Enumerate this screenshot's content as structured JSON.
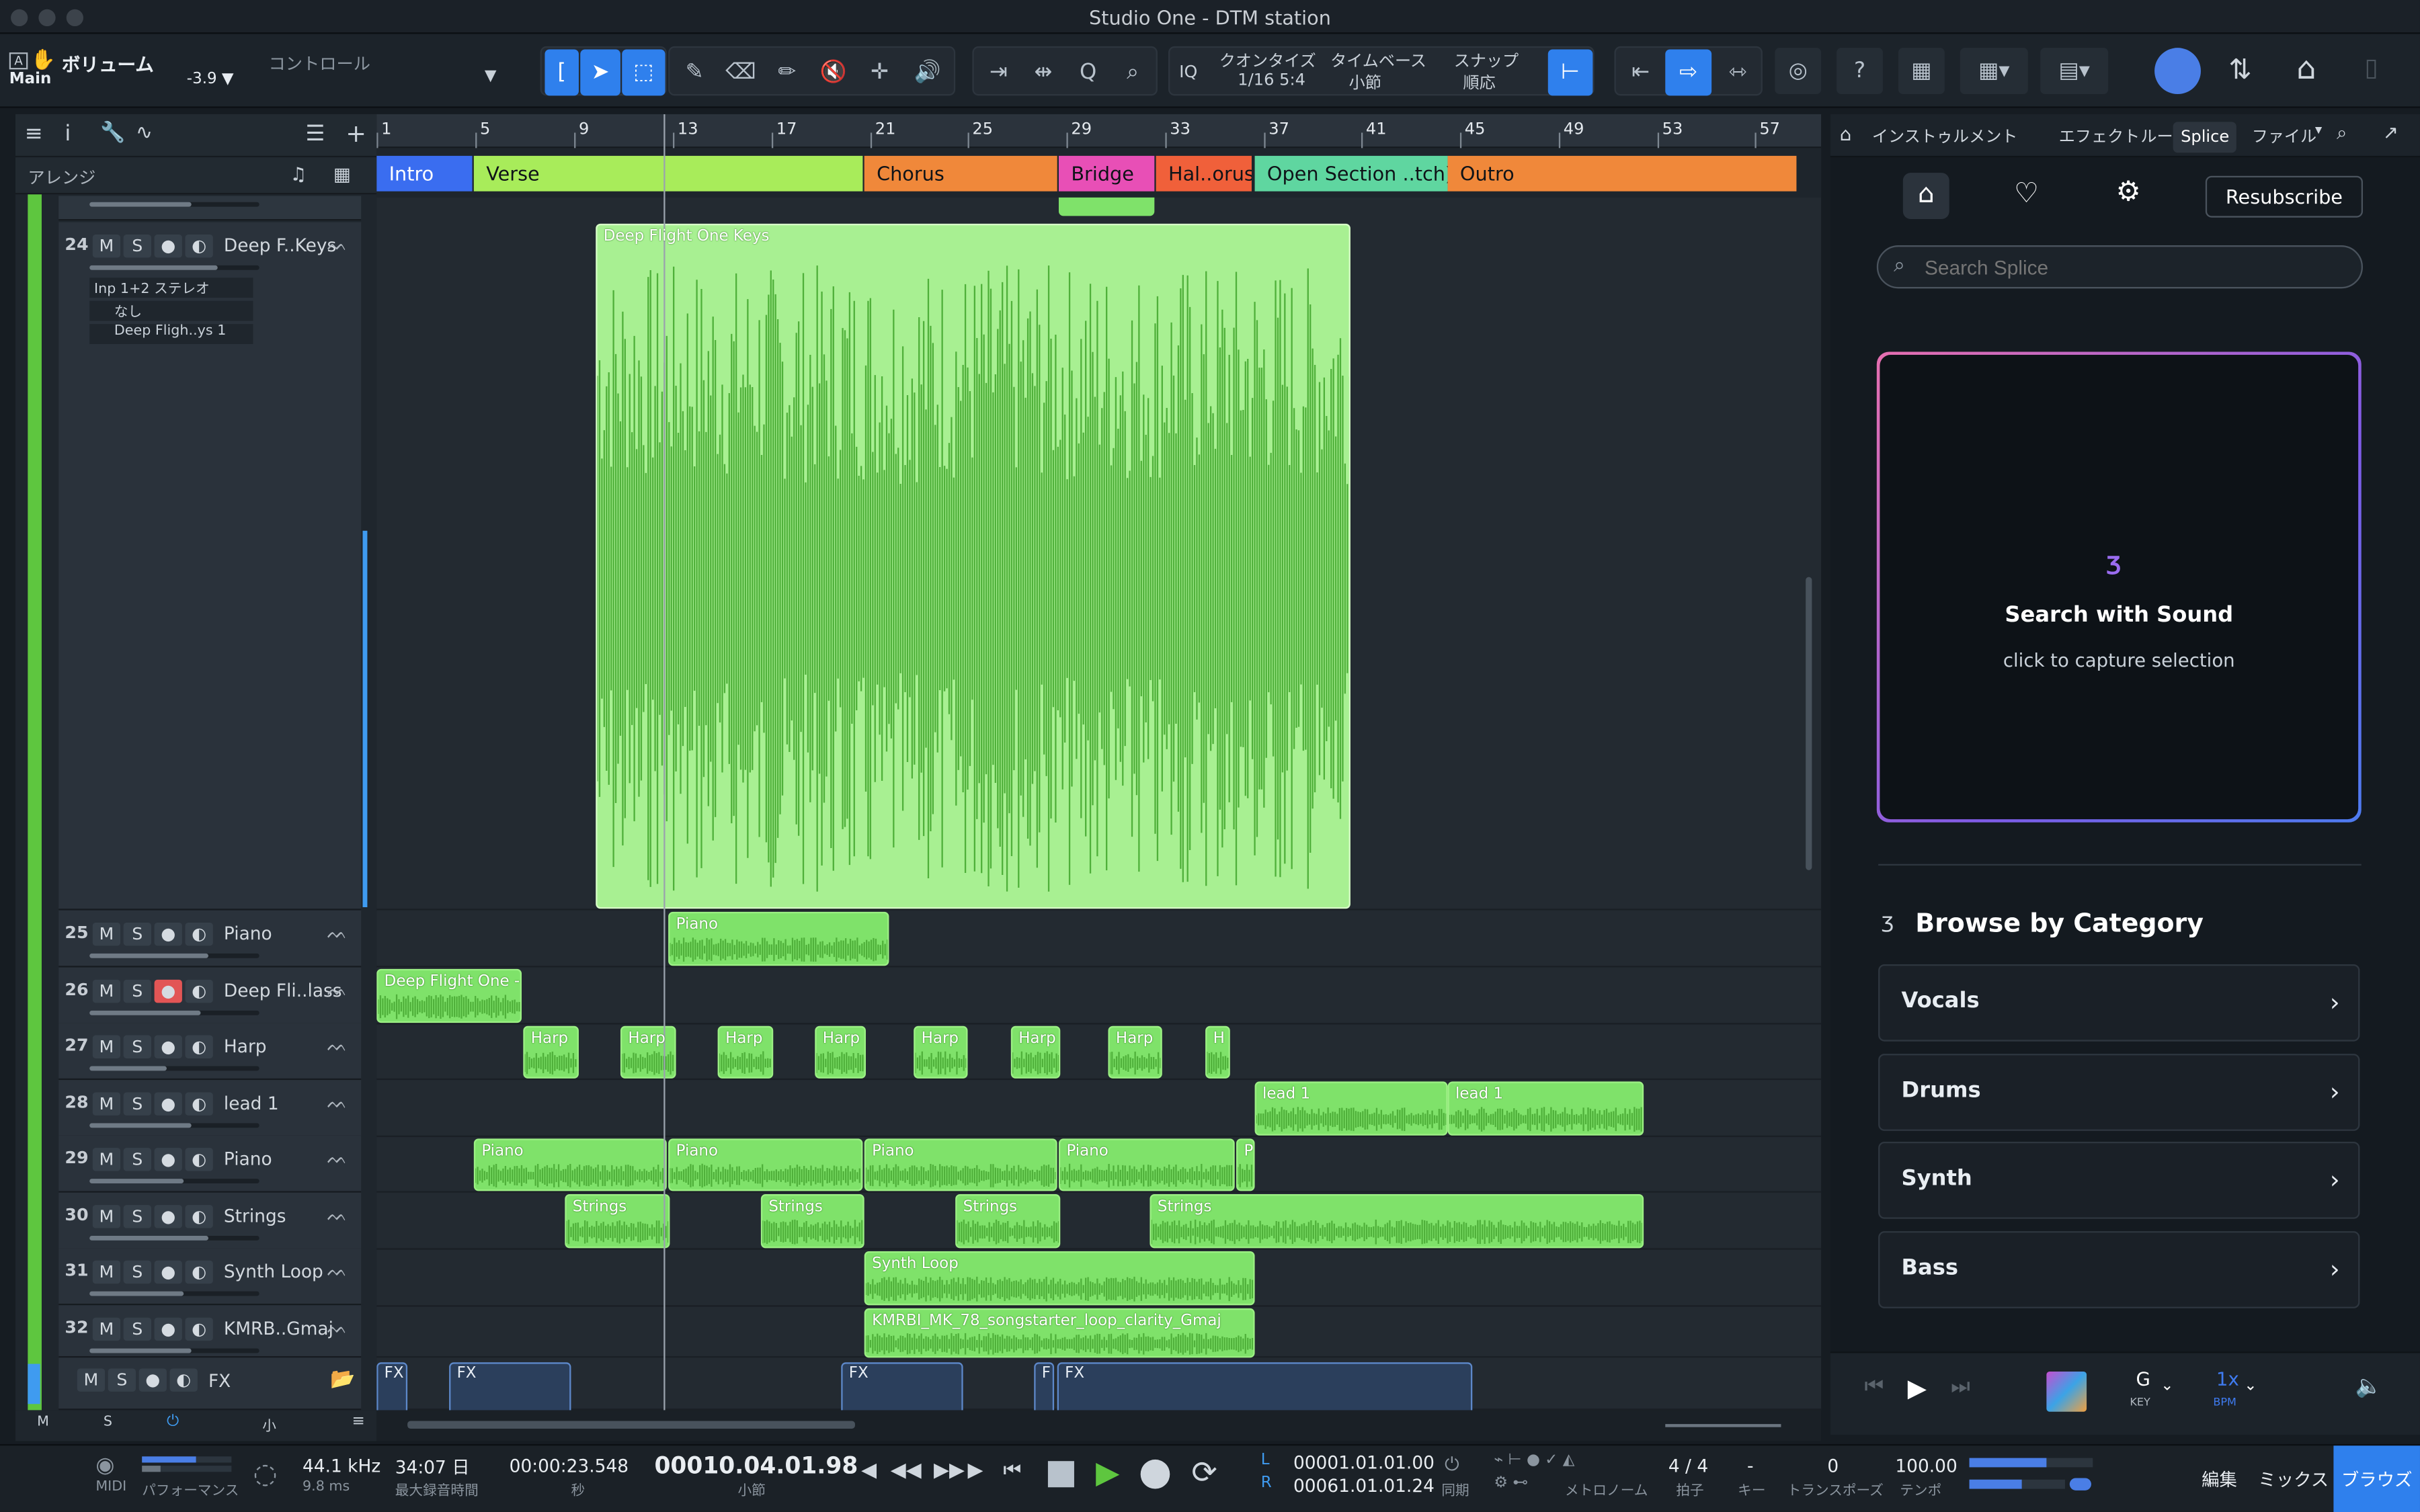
{
  "window": {
    "title": "Studio One - DTM station"
  },
  "toolbar": {
    "left_top": "A",
    "volume_label": "ボリューム",
    "control_label": "コントロール",
    "main_label": "Main",
    "volume_value": "-3.9 ▼",
    "iq": "IQ",
    "quantize_label": "クオンタイズ",
    "quantize_value": "1/16 5:4",
    "timebase_label": "タイムベース",
    "timebase_value": "小節",
    "snap_label": "スナップ",
    "snap_value": "順応",
    "help": "?"
  },
  "arrange_header": {
    "label": "アレンジ"
  },
  "ruler": {
    "bars": [
      "1",
      "5",
      "9",
      "13",
      "17",
      "21",
      "25",
      "29",
      "33",
      "37",
      "41",
      "45",
      "49",
      "53",
      "57"
    ]
  },
  "markers": [
    {
      "label": "Intro",
      "color": "#3a6df0"
    },
    {
      "label": "Verse",
      "color": "#a8ec5a"
    },
    {
      "label": "Chorus",
      "color": "#f0883a"
    },
    {
      "label": "Bridge",
      "color": "#e84fb6"
    },
    {
      "label": "Hal..orus",
      "color": "#f0603a"
    },
    {
      "label": "Open Section ..tch)",
      "color": "#5fd6a0"
    },
    {
      "label": "Outro",
      "color": "#f0883a"
    }
  ],
  "tracks": {
    "t24": {
      "num": "24",
      "name": "Deep F..Keys",
      "input": "Inp 1+2 ステレオ",
      "insert": "なし",
      "instrument": "Deep Fligh..ys 1",
      "clip": "Deep Flight One Keys",
      "volume": 0.75
    },
    "t25": {
      "num": "25",
      "name": "Piano",
      "clip": "Piano",
      "volume": 0.7
    },
    "t26": {
      "num": "26",
      "name": "Deep Fli..lass",
      "clip": "Deep Flight One - F",
      "volume": 0.65
    },
    "t27": {
      "num": "27",
      "name": "Harp",
      "clips": [
        "Harp",
        "Harp",
        "Harp",
        "Harp",
        "Harp",
        "Harp",
        "Harp",
        "H"
      ],
      "volume": 0.45
    },
    "t28": {
      "num": "28",
      "name": "lead 1",
      "clips": [
        "lead 1",
        "lead 1"
      ],
      "volume": 0.6
    },
    "t29": {
      "num": "29",
      "name": "Piano",
      "clips": [
        "Piano",
        "Piano",
        "Piano",
        "Piano",
        "P"
      ],
      "volume": 0.55
    },
    "t30": {
      "num": "30",
      "name": "Strings",
      "clips": [
        "Strings",
        "Strings",
        "Strings",
        "Strings"
      ],
      "volume": 0.7
    },
    "t31": {
      "num": "31",
      "name": "Synth Loop",
      "clip": "Synth Loop",
      "volume": 0.55
    },
    "t32": {
      "num": "32",
      "name": "KMRB..Gmaj",
      "clip": "KMRBI_MK_78_songstarter_loop_clarity_Gmaj",
      "volume": 0.6
    },
    "fx": {
      "name": "FX",
      "clips": [
        "FX",
        "FX",
        "FX",
        "F",
        "FX"
      ]
    }
  },
  "track_buttons": {
    "mute": "M",
    "solo": "S"
  },
  "bottom_left": {
    "m": "M",
    "s": "S",
    "size": "小"
  },
  "browser": {
    "tabs": [
      "インストゥルメント",
      "エフェクト",
      "ループ",
      "Splice",
      "ファイル"
    ],
    "active_tab": "Splice",
    "resubscribe": "Resubscribe",
    "search_placeholder": "Search Splice",
    "sws_title": "Search with Sound",
    "sws_sub": "click to capture selection",
    "browse_title": "Browse by Category",
    "categories": [
      "Vocals",
      "Drums",
      "Synth",
      "Bass"
    ],
    "player": {
      "key": "G",
      "key_label": "KEY",
      "bpm": "1x",
      "bpm_label": "BPM"
    }
  },
  "status": {
    "midi": "MIDI",
    "performance": "パフォーマンス",
    "sample_rate": "44.1 kHz",
    "latency": "9.8 ms",
    "record_time": "34:07 日",
    "record_time_label": "最大録音時間",
    "seconds": "00:00:23.548",
    "seconds_label": "秒",
    "position": "00010.04.01.98",
    "position_label": "小節",
    "loop_l": "00001.01.01.00",
    "loop_r": "00061.01.01.24",
    "sync": "同期",
    "metronome": "メトロノーム",
    "signature": "4 / 4",
    "signature_label": "拍子",
    "key": "-",
    "key_label": "キー",
    "transpose": "0",
    "transpose_label": "トランスポーズ",
    "tempo": "100.00",
    "tempo_label": "テンポ",
    "edit": "編集",
    "mix": "ミックス",
    "browse": "ブラウズ"
  },
  "colors": {
    "accent": "#2f80ed",
    "clip": "#7fe26a",
    "clip_wave": "#4fb03a",
    "record": "#e25555"
  }
}
